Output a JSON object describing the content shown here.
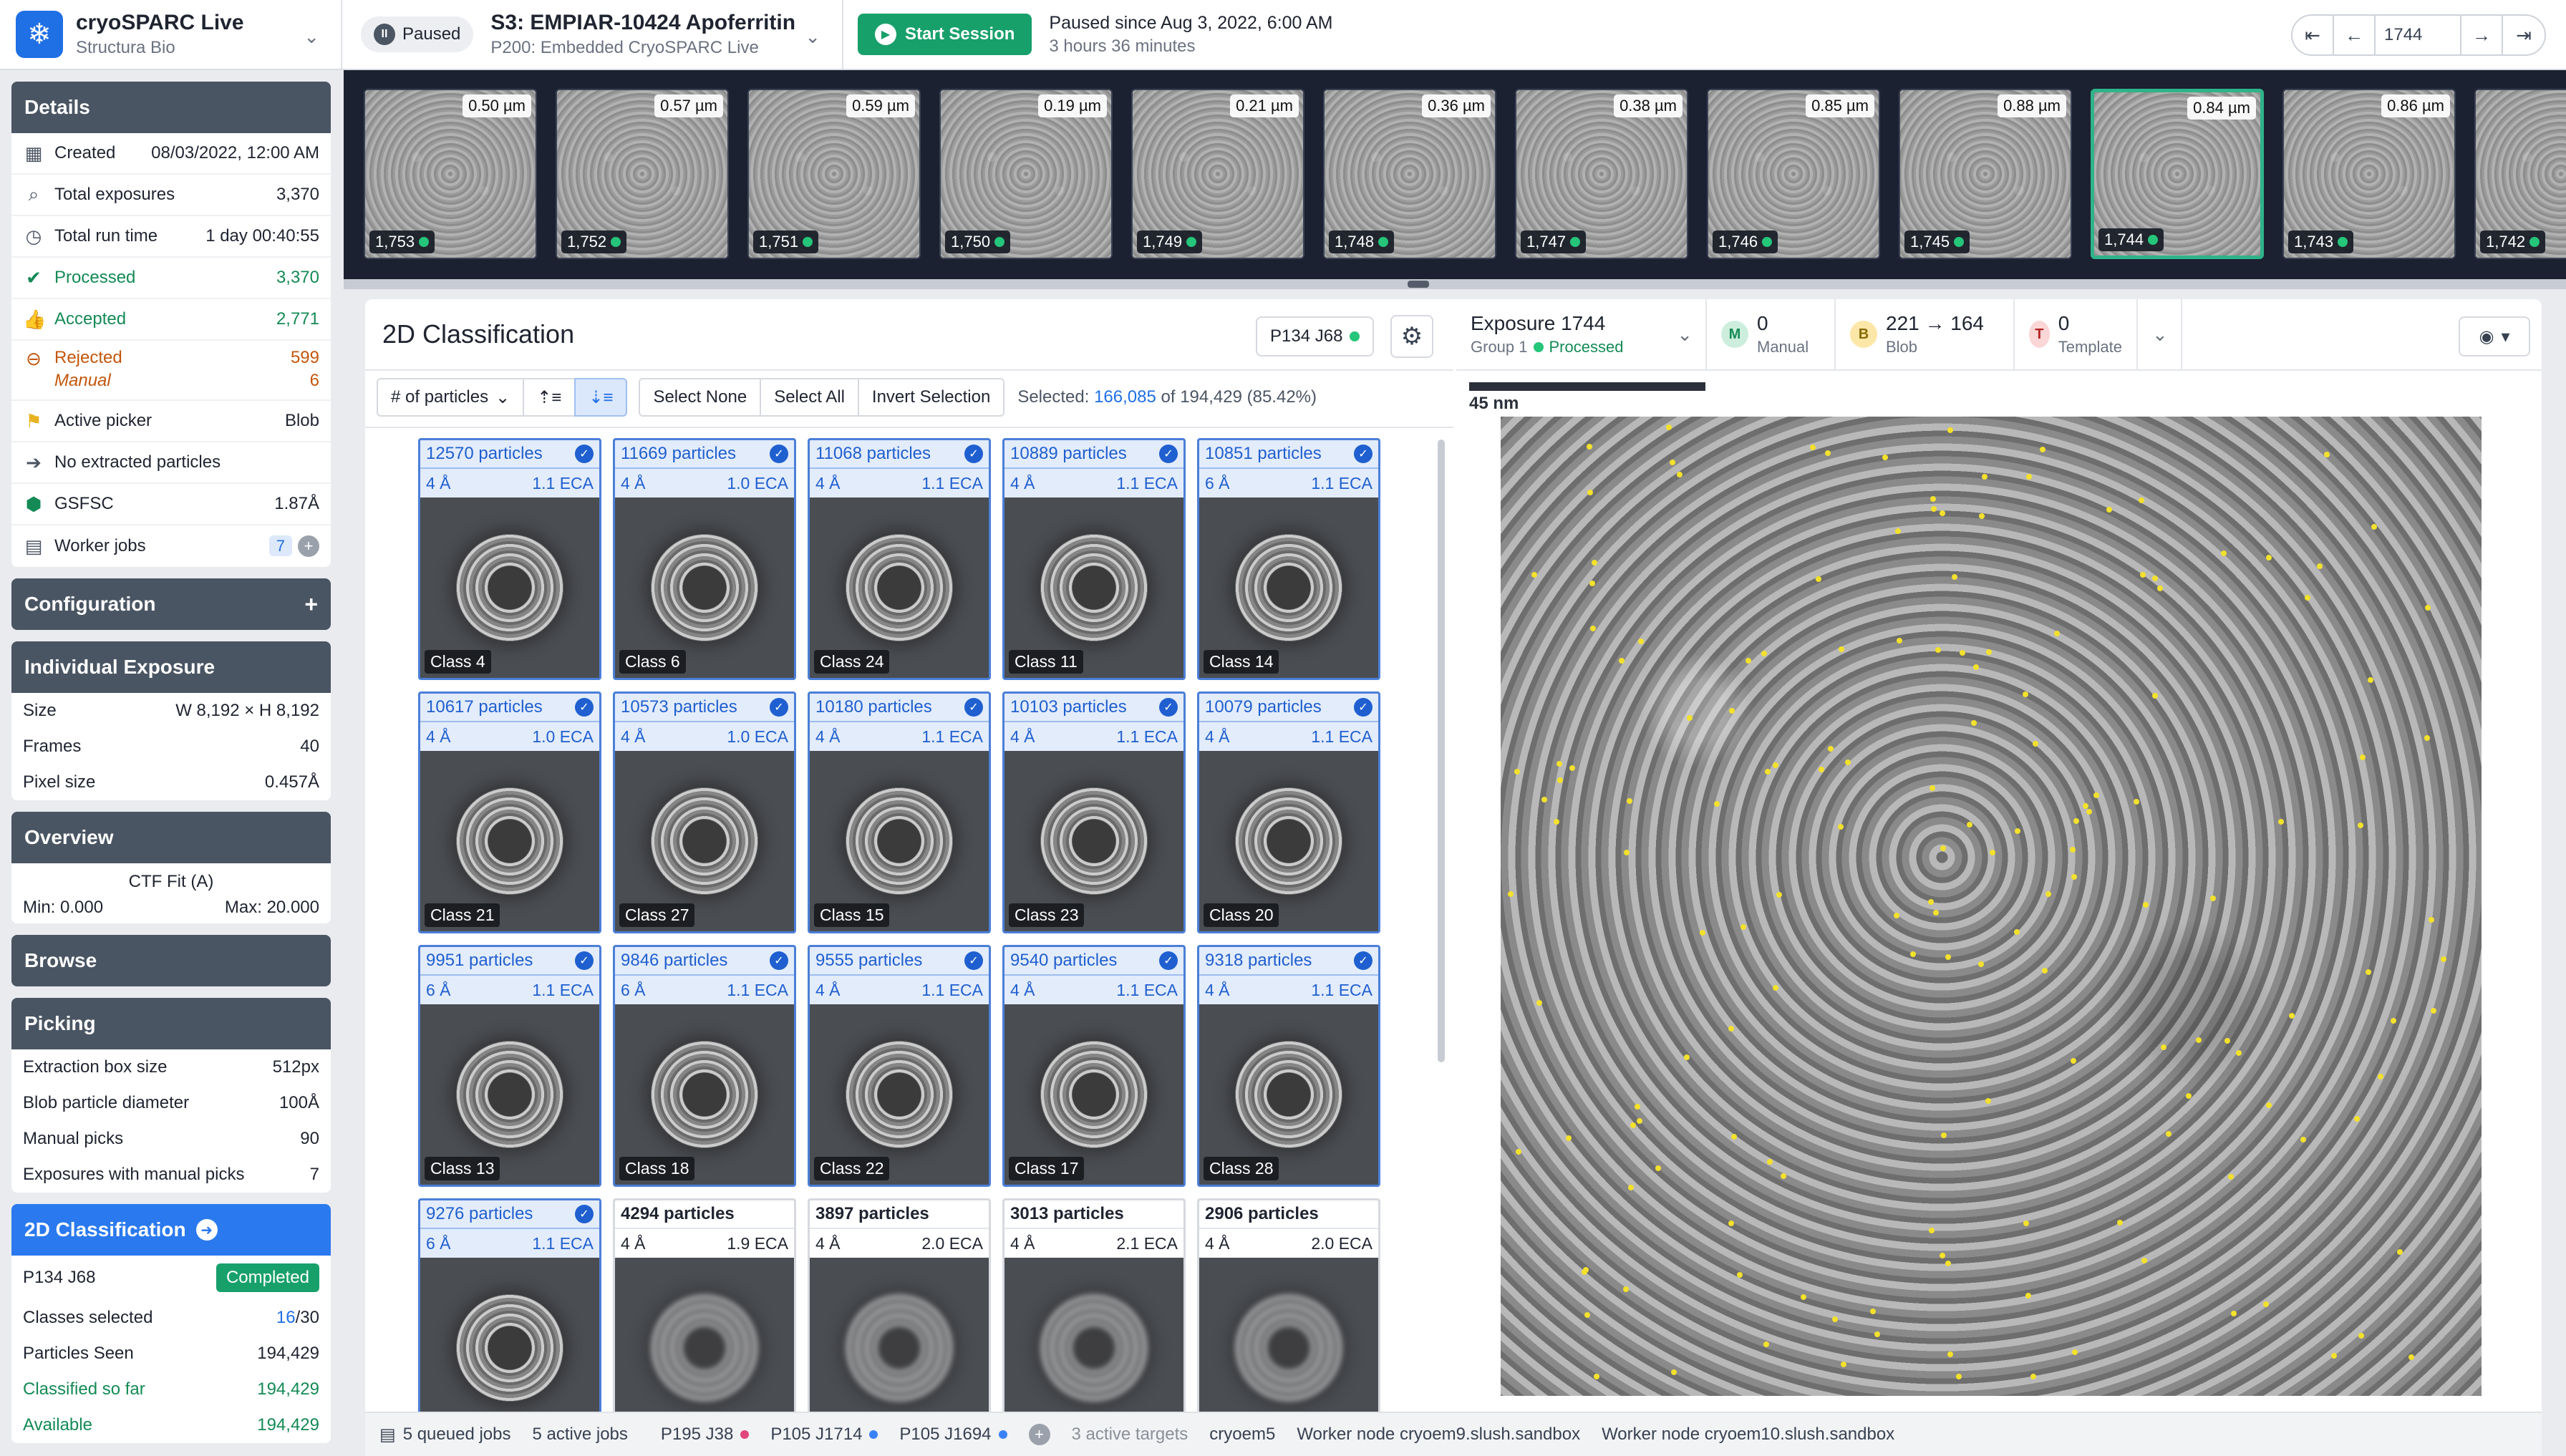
{
  "app": {
    "title": "cryoSPARC Live",
    "org": "Structura Bio"
  },
  "session": {
    "status": "Paused",
    "title": "S3: EMPIAR-10424 Apoferritin",
    "subtitle": "P200: Embedded CryoSPARC Live",
    "start_label": "Start Session",
    "paused_since": "Paused since Aug 3, 2022, 6:00 AM",
    "paused_duration": "3 hours 36 minutes"
  },
  "nav": {
    "exposure_value": "1744"
  },
  "filmstrip": [
    {
      "ctf": "0.50 µm",
      "id": "1,753"
    },
    {
      "ctf": "0.57 µm",
      "id": "1,752"
    },
    {
      "ctf": "0.59 µm",
      "id": "1,751"
    },
    {
      "ctf": "0.19 µm",
      "id": "1,750"
    },
    {
      "ctf": "0.21 µm",
      "id": "1,749"
    },
    {
      "ctf": "0.36 µm",
      "id": "1,748"
    },
    {
      "ctf": "0.38 µm",
      "id": "1,747"
    },
    {
      "ctf": "0.85 µm",
      "id": "1,746"
    },
    {
      "ctf": "0.88 µm",
      "id": "1,745"
    },
    {
      "ctf": "0.84 µm",
      "id": "1,744"
    },
    {
      "ctf": "0.86 µm",
      "id": "1,743"
    },
    {
      "ctf": "",
      "id": "1,742"
    }
  ],
  "details": {
    "heading": "Details",
    "created_label": "Created",
    "created_value": "08/03/2022, 12:00 AM",
    "total_exposures_label": "Total exposures",
    "total_exposures_value": "3,370",
    "run_time_label": "Total run time",
    "run_time_value": "1 day 00:40:55",
    "processed_label": "Processed",
    "processed_value": "3,370",
    "accepted_label": "Accepted",
    "accepted_value": "2,771",
    "rejected_label": "Rejected",
    "rejected_value": "599",
    "manual_label": "Manual",
    "manual_value": "6",
    "picker_label": "Active picker",
    "picker_value": "Blob",
    "extracted_label": "No extracted particles",
    "gsfsc_label": "GSFSC",
    "gsfsc_value": "1.87Å",
    "worker_label": "Worker jobs",
    "worker_value": "7"
  },
  "configuration": {
    "heading": "Configuration"
  },
  "individual_exposure": {
    "heading": "Individual Exposure",
    "size_label": "Size",
    "size_value": "W 8,192 × H 8,192",
    "frames_label": "Frames",
    "frames_value": "40",
    "pixel_label": "Pixel size",
    "pixel_value": "0.457Å"
  },
  "overview": {
    "heading": "Overview",
    "ctf_label": "CTF Fit (A)",
    "min": "Min: 0.000",
    "max": "Max: 20.000"
  },
  "browse": {
    "heading": "Browse"
  },
  "picking": {
    "heading": "Picking",
    "box_label": "Extraction box size",
    "box_value": "512px",
    "blob_label": "Blob particle diameter",
    "blob_value": "100Å",
    "manual_label": "Manual picks",
    "manual_value": "90",
    "exp_manual_label": "Exposures with manual picks",
    "exp_manual_value": "7"
  },
  "classification_panel": {
    "heading": "2D Classification",
    "job": "P134 J68",
    "status": "Completed",
    "classes_label": "Classes selected",
    "classes_sel": "16",
    "classes_total": "/30",
    "seen_label": "Particles Seen",
    "seen_value": "194,429",
    "classified_label": "Classified so far",
    "classified_value": "194,429",
    "available_label": "Available",
    "available_value": "194,429"
  },
  "main": {
    "title": "2D Classification",
    "job_pill": "P134 J68",
    "sort_label": "# of particles",
    "select_none": "Select None",
    "select_all": "Select All",
    "invert": "Invert Selection",
    "selected_prefix": "Selected:",
    "selected_count": "166,085",
    "selected_suffix": "of 194,429 (85.42%)"
  },
  "classes": [
    {
      "particles": "12570 particles",
      "res": "4 Å",
      "eca": "1.1 ECA",
      "name": "Class 4",
      "selected": true
    },
    {
      "particles": "11669 particles",
      "res": "4 Å",
      "eca": "1.0 ECA",
      "name": "Class 6",
      "selected": true
    },
    {
      "particles": "11068 particles",
      "res": "4 Å",
      "eca": "1.1 ECA",
      "name": "Class 24",
      "selected": true
    },
    {
      "particles": "10889 particles",
      "res": "4 Å",
      "eca": "1.1 ECA",
      "name": "Class 11",
      "selected": true
    },
    {
      "particles": "10851 particles",
      "res": "6 Å",
      "eca": "1.1 ECA",
      "name": "Class 14",
      "selected": true
    },
    {
      "particles": "10617 particles",
      "res": "4 Å",
      "eca": "1.0 ECA",
      "name": "Class 21",
      "selected": true
    },
    {
      "particles": "10573 particles",
      "res": "4 Å",
      "eca": "1.0 ECA",
      "name": "Class 27",
      "selected": true
    },
    {
      "particles": "10180 particles",
      "res": "4 Å",
      "eca": "1.1 ECA",
      "name": "Class 15",
      "selected": true
    },
    {
      "particles": "10103 particles",
      "res": "4 Å",
      "eca": "1.1 ECA",
      "name": "Class 23",
      "selected": true
    },
    {
      "particles": "10079 particles",
      "res": "4 Å",
      "eca": "1.1 ECA",
      "name": "Class 20",
      "selected": true
    },
    {
      "particles": "9951 particles",
      "res": "6 Å",
      "eca": "1.1 ECA",
      "name": "Class 13",
      "selected": true
    },
    {
      "particles": "9846 particles",
      "res": "6 Å",
      "eca": "1.1 ECA",
      "name": "Class 18",
      "selected": true
    },
    {
      "particles": "9555 particles",
      "res": "4 Å",
      "eca": "1.1 ECA",
      "name": "Class 22",
      "selected": true
    },
    {
      "particles": "9540 particles",
      "res": "4 Å",
      "eca": "1.1 ECA",
      "name": "Class 17",
      "selected": true
    },
    {
      "particles": "9318 particles",
      "res": "4 Å",
      "eca": "1.1 ECA",
      "name": "Class 28",
      "selected": true
    },
    {
      "particles": "9276 particles",
      "res": "6 Å",
      "eca": "1.1 ECA",
      "name": "",
      "selected": true
    },
    {
      "particles": "4294 particles",
      "res": "4 Å",
      "eca": "1.9 ECA",
      "name": "",
      "selected": false
    },
    {
      "particles": "3897 particles",
      "res": "4 Å",
      "eca": "2.0 ECA",
      "name": "",
      "selected": false
    },
    {
      "particles": "3013 particles",
      "res": "4 Å",
      "eca": "2.1 ECA",
      "name": "",
      "selected": false
    },
    {
      "particles": "2906 particles",
      "res": "4 Å",
      "eca": "2.0 ECA",
      "name": "",
      "selected": false
    }
  ],
  "exposure": {
    "title": "Exposure 1744",
    "group": "Group 1",
    "status": "Processed",
    "manual_count": "0",
    "manual_label": "Manual",
    "manual_badge": "M",
    "blob_count": "221 → 164",
    "blob_label": "Blob",
    "blob_badge": "B",
    "template_count": "0",
    "template_label": "Template",
    "template_badge": "T",
    "scale_label": "45 nm"
  },
  "statusbar": {
    "queued": "5 queued jobs",
    "active": "5 active jobs",
    "job1": "P195 J38",
    "job2": "P105 J1714",
    "job3": "P105 J1694",
    "targets": "3 active targets",
    "target1": "cryoem5",
    "node1": "Worker node cryoem9.slush.sandbox",
    "node2": "Worker node cryoem10.slush.sandbox"
  },
  "colors": {
    "accent": "#1f6fe5",
    "success": "#18a06b",
    "sidebar_header": "#4a5563",
    "film_bg": "#1b2130"
  }
}
